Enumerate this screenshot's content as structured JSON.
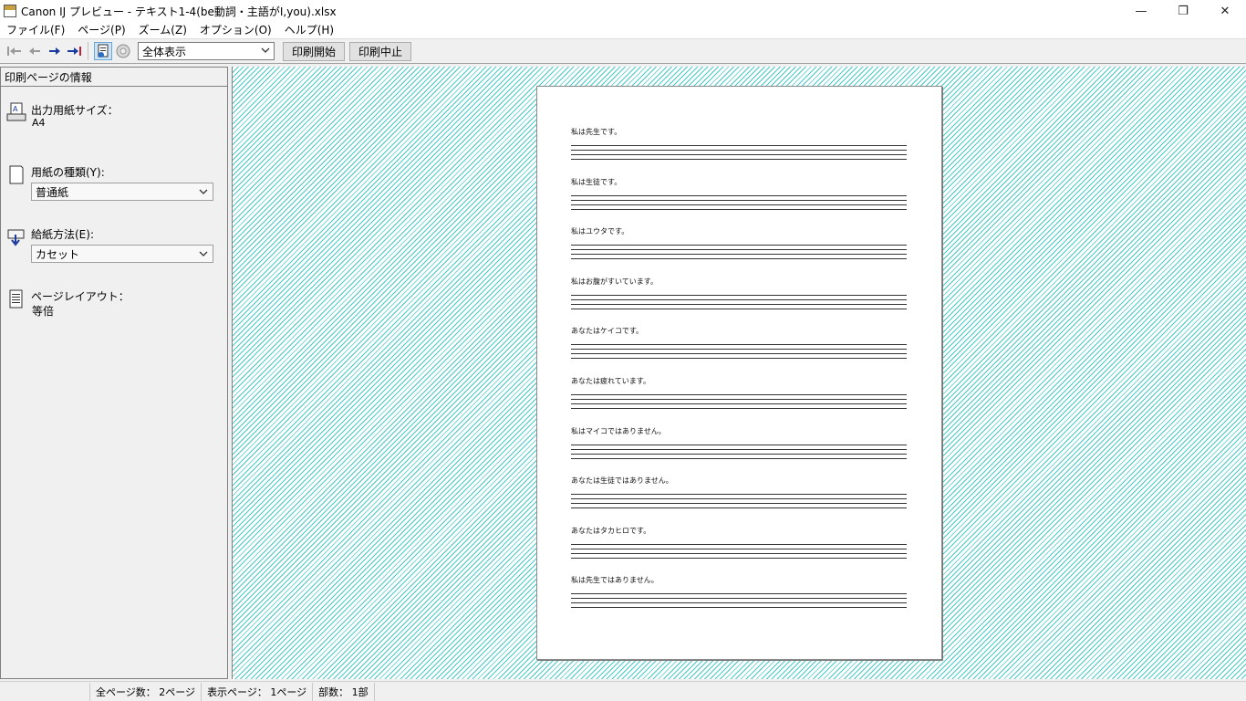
{
  "window": {
    "title": "Canon IJ プレビュー - テキスト1-4(be動詞・主語がI,you).xlsx",
    "minimize": "—",
    "maximize": "❐",
    "close": "✕"
  },
  "menu": [
    "ファイル(F)",
    "ページ(P)",
    "ズーム(Z)",
    "オプション(O)",
    "ヘルプ(H)"
  ],
  "toolbar": {
    "zoom_value": "全体表示",
    "start_print": "印刷開始",
    "cancel_print": "印刷中止"
  },
  "panel": {
    "header": "印刷ページの情報",
    "paper_size_label": "出力用紙サイズ：",
    "paper_size_value": "A4",
    "media_type_label": "用紙の種類(Y):",
    "media_type_value": "普通紙",
    "paper_source_label": "給紙方法(E):",
    "paper_source_value": "カセット",
    "layout_label": "ページレイアウト：",
    "layout_value": "等倍"
  },
  "page": {
    "sentences": [
      "私は先生です。",
      "私は生徒です。",
      "私はユウタです。",
      "私はお腹がすいています。",
      "あなたはケイコです。",
      "あなたは疲れています。",
      "私はマイコではありません。",
      "あなたは生徒ではありません。",
      "あなたはタカヒロです。",
      "私は先生ではありません。"
    ]
  },
  "status": {
    "total_pages": "全ページ数： 2ページ",
    "current_page": "表示ページ： 1ページ",
    "copies": "部数： 1部"
  },
  "colors": {
    "hatch": "#48c9c9",
    "active_tool": "#cce4f7"
  }
}
